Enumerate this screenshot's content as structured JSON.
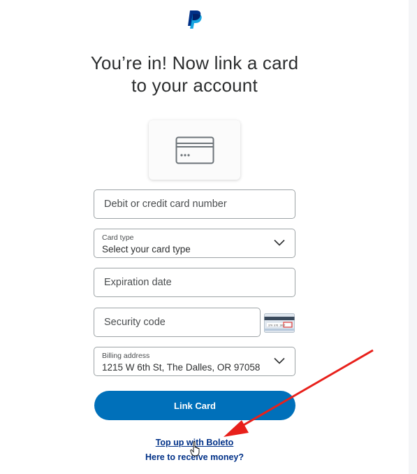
{
  "brand": {
    "logo_icon": "paypal-logo-icon",
    "color_dark": "#003087",
    "color_light": "#009cde"
  },
  "headline": {
    "line1": "You’re in! Now link a card",
    "line2": "to your account"
  },
  "card_illustration": {
    "icon": "credit-card-icon"
  },
  "form": {
    "card_number": {
      "placeholder": "Debit or credit card number"
    },
    "card_type": {
      "label": "Card type",
      "value": "Select your card type",
      "icon": "chevron-down-icon"
    },
    "expiration": {
      "placeholder": "Expiration date"
    },
    "security_code": {
      "placeholder": "Security code",
      "icon": "card-back-cvv-icon",
      "cvv_sample": "370 576 1057"
    },
    "billing_address": {
      "label": "Billing address",
      "value": "1215 W 6th St, The Dalles, OR 97058",
      "icon": "chevron-down-icon"
    }
  },
  "actions": {
    "link_card": "Link Card",
    "top_up": "Top up with Boleto",
    "receive_money": "Here to receive money?"
  },
  "colors": {
    "primary_button": "#0070ba",
    "link": "#003087",
    "annotation_arrow": "#e8201b"
  }
}
